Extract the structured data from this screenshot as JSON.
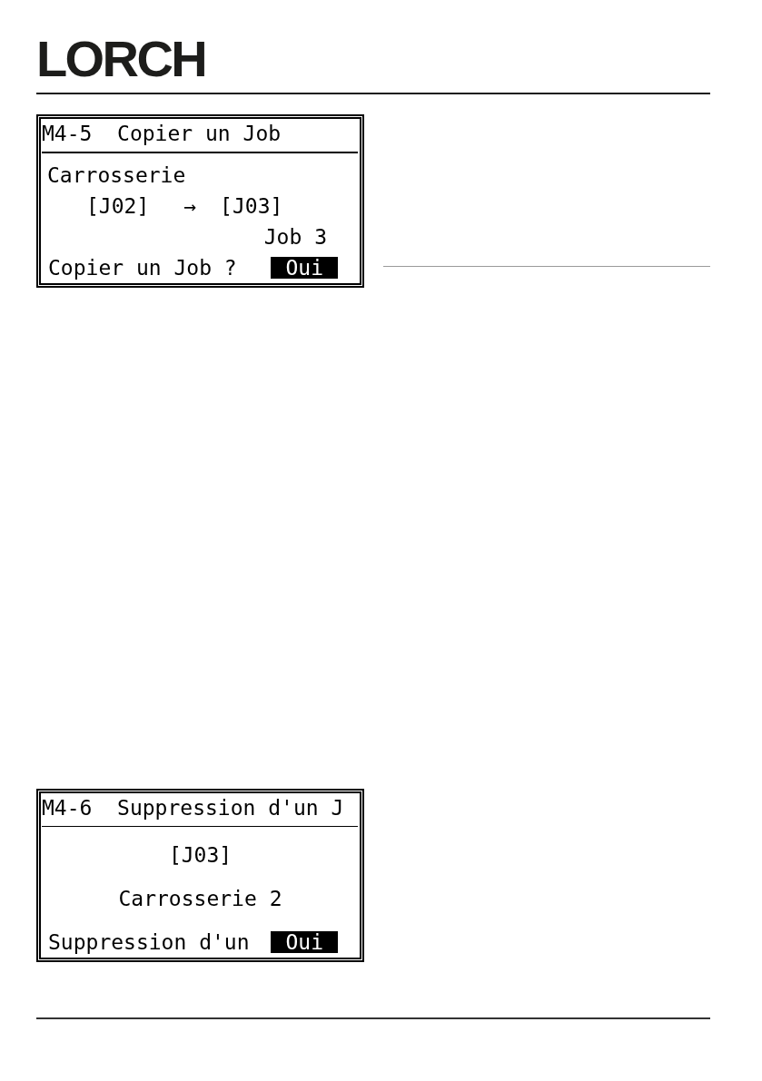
{
  "header": {
    "logo": "LORCH"
  },
  "screens": [
    {
      "kind": "copy",
      "title": "M4-5  Copier un Job",
      "source_name": "Carrosserie",
      "source_job": "[J02]",
      "arrow": "→",
      "target_job": "[J03]",
      "target_name": "Job 3",
      "prompt": "Copier un Job ?",
      "answer": {
        "label": "Oui",
        "selected": true
      }
    },
    {
      "kind": "delete",
      "title": "M4-6  Suppression d'un J",
      "job": "[J03]",
      "name": "Carrosserie 2",
      "prompt": "Suppression d'un",
      "answer": {
        "label": "Oui",
        "selected": true
      }
    }
  ]
}
